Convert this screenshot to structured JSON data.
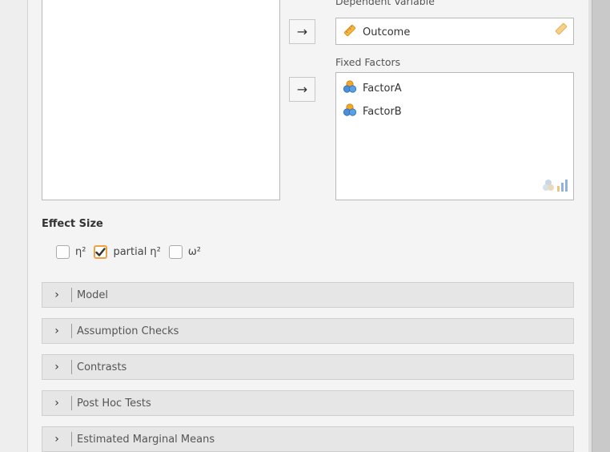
{
  "variables": {
    "dependent_label": "Dependent Variable",
    "dependent_items": [
      {
        "name": "Outcome",
        "icon": "ruler-continuous-icon"
      }
    ],
    "fixed_label": "Fixed Factors",
    "fixed_items": [
      {
        "name": "FactorA",
        "icon": "nominal-factor-icon"
      },
      {
        "name": "FactorB",
        "icon": "nominal-factor-icon"
      }
    ],
    "arrow_symbol": "→"
  },
  "effect_size": {
    "title": "Effect Size",
    "options": [
      {
        "label": "η²",
        "checked": false
      },
      {
        "label": "partial η²",
        "checked": true
      },
      {
        "label": "ω²",
        "checked": false
      }
    ]
  },
  "sections": [
    {
      "label": "Model",
      "expanded": false
    },
    {
      "label": "Assumption Checks",
      "expanded": false
    },
    {
      "label": "Contrasts",
      "expanded": false
    },
    {
      "label": "Post Hoc Tests",
      "expanded": false
    },
    {
      "label": "Estimated Marginal Means",
      "expanded": false
    }
  ],
  "chevron_symbol": "›",
  "colors": {
    "accent": "#f0a040",
    "panel_bg": "#f4f4f4",
    "section_bg": "#e6e6e6"
  }
}
